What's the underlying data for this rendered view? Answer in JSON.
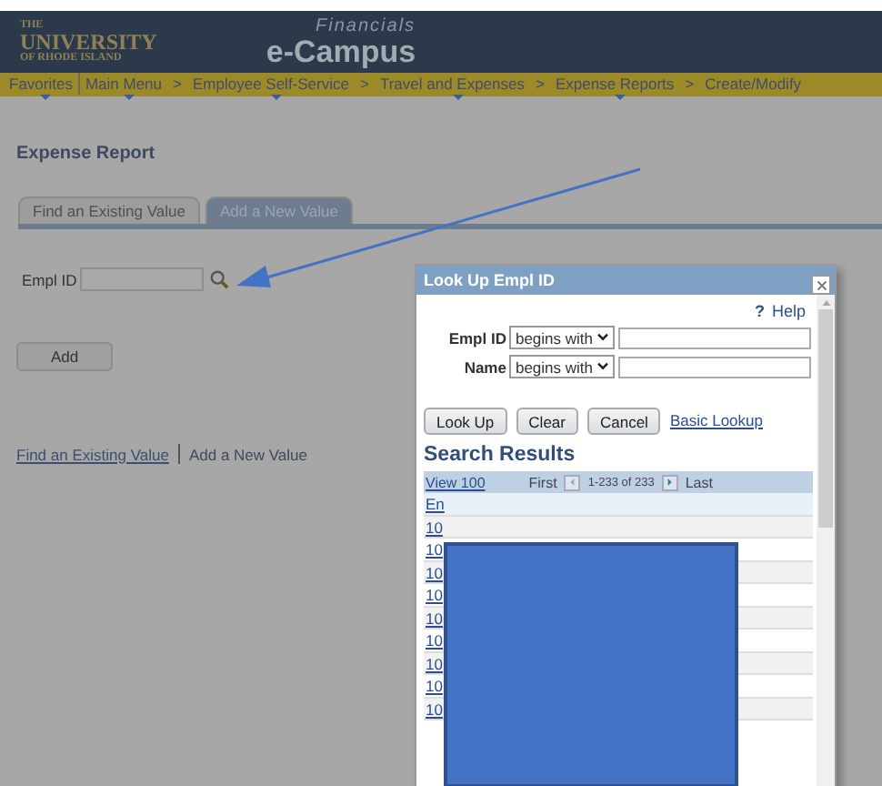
{
  "header": {
    "org_small": "THE",
    "org_big": "UNIVERSITY",
    "org_sub": "OF RHODE ISLAND",
    "app_super": "Financials",
    "app_name": "e-Campus"
  },
  "nav": [
    {
      "kind": "link",
      "label": "Favorites",
      "menu": true
    },
    {
      "kind": "link",
      "label": "Main Menu",
      "menu": true
    },
    {
      "kind": "separator",
      "label": ">"
    },
    {
      "kind": "link",
      "label": "Employee Self-Service",
      "menu": true
    },
    {
      "kind": "separator",
      "label": ">"
    },
    {
      "kind": "link",
      "label": "Travel and Expenses",
      "menu": true
    },
    {
      "kind": "separator",
      "label": ">"
    },
    {
      "kind": "link",
      "label": "Expense Reports",
      "menu": true
    },
    {
      "kind": "separator",
      "label": ">"
    },
    {
      "kind": "link",
      "label": "Create/Modify",
      "menu": false
    }
  ],
  "page": {
    "title": "Expense Report",
    "tabs": [
      {
        "label": "Find an Existing Value",
        "selected": false
      },
      {
        "label": "Add a New Value",
        "selected": true
      }
    ],
    "field_label": "Empl ID",
    "button": "Add",
    "footer": [
      {
        "kind": "link",
        "label": "Find an Existing Value"
      },
      {
        "kind": "text",
        "label": "Add a New Value"
      }
    ]
  },
  "popup": {
    "title": "Look Up Empl ID",
    "help_mark": "?",
    "help": "Help",
    "criteria": [
      {
        "label": "Empl ID",
        "operator": "begins with"
      },
      {
        "label": "Name",
        "operator": "begins with"
      }
    ],
    "buttons": [
      "Look Up",
      "Clear",
      "Cancel"
    ],
    "link": "Basic Lookup",
    "results_title": "Search Results",
    "view": "View 100",
    "first": "First",
    "range": "1-233 of 233",
    "last": "Last",
    "column_1": "En",
    "rows": [
      "10",
      "10",
      "10",
      "10",
      "10",
      "10",
      "10",
      "10",
      "10"
    ]
  }
}
